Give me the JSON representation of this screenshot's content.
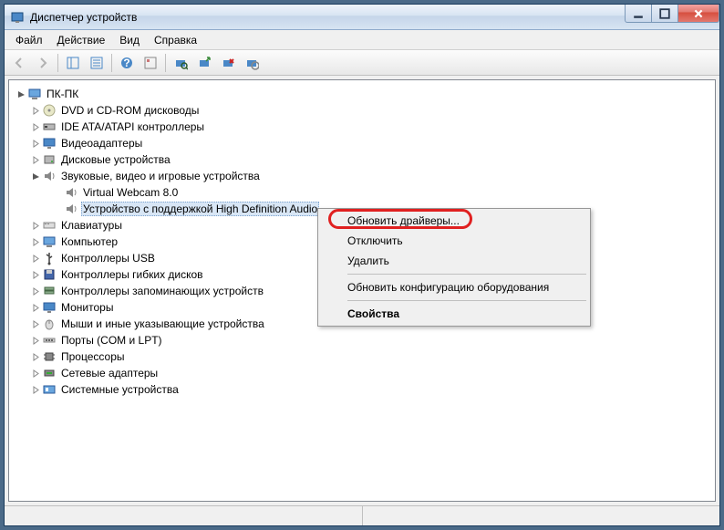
{
  "title": "Диспетчер устройств",
  "menubar": [
    "Файл",
    "Действие",
    "Вид",
    "Справка"
  ],
  "root": "ПК-ПК",
  "categories": [
    {
      "label": "DVD и CD-ROM дисководы",
      "expanded": false,
      "icon": "disc"
    },
    {
      "label": "IDE ATA/ATAPI контроллеры",
      "expanded": false,
      "icon": "ide"
    },
    {
      "label": "Видеоадаптеры",
      "expanded": false,
      "icon": "display"
    },
    {
      "label": "Дисковые устройства",
      "expanded": false,
      "icon": "disk"
    },
    {
      "label": "Звуковые, видео и игровые устройства",
      "expanded": true,
      "icon": "sound",
      "children": [
        {
          "label": "Virtual Webcam 8.0",
          "icon": "sound"
        },
        {
          "label": "Устройство с поддержкой High Definition Audio",
          "icon": "sound",
          "selected": true
        }
      ]
    },
    {
      "label": "Клавиатуры",
      "expanded": false,
      "icon": "keyboard"
    },
    {
      "label": "Компьютер",
      "expanded": false,
      "icon": "computer"
    },
    {
      "label": "Контроллеры USB",
      "expanded": false,
      "icon": "usb"
    },
    {
      "label": "Контроллеры гибких дисков",
      "expanded": false,
      "icon": "floppy"
    },
    {
      "label": "Контроллеры запоминающих устройств",
      "expanded": false,
      "icon": "storage"
    },
    {
      "label": "Мониторы",
      "expanded": false,
      "icon": "monitor"
    },
    {
      "label": "Мыши и иные указывающие устройства",
      "expanded": false,
      "icon": "mouse"
    },
    {
      "label": "Порты (COM и LPT)",
      "expanded": false,
      "icon": "port"
    },
    {
      "label": "Процессоры",
      "expanded": false,
      "icon": "cpu"
    },
    {
      "label": "Сетевые адаптеры",
      "expanded": false,
      "icon": "network"
    },
    {
      "label": "Системные устройства",
      "expanded": false,
      "icon": "system"
    }
  ],
  "context_menu": {
    "update": "Обновить драйверы...",
    "disable": "Отключить",
    "delete": "Удалить",
    "rescan": "Обновить конфигурацию оборудования",
    "properties": "Свойства"
  }
}
